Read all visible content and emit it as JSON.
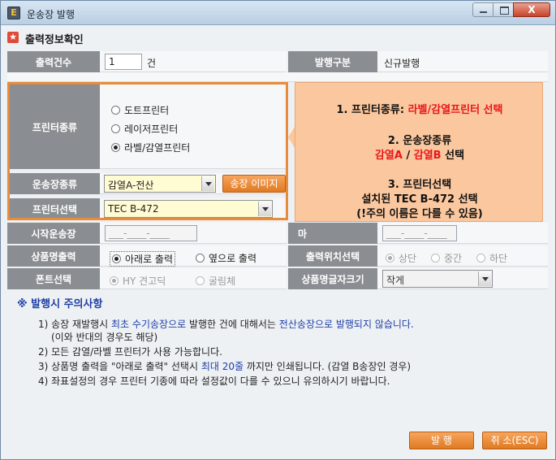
{
  "window": {
    "title": "운송장 발행",
    "close_glyph": "X",
    "app_glyph": "E"
  },
  "section": {
    "title": "출력정보확인",
    "icon_glyph": "★"
  },
  "form": {
    "print_count": {
      "label": "출력건수",
      "value": "1",
      "unit": "건"
    },
    "issue_type": {
      "label": "발행구분",
      "value": "신규발행"
    },
    "printer_type": {
      "label": "프린터종류",
      "options": [
        "도트프린터",
        "레이저프린터",
        "라벨/감열프린터"
      ],
      "selected": 2
    },
    "waybill_type": {
      "label": "운송장종류",
      "value": "감열A-전산",
      "image_button": "송장 이미지"
    },
    "printer_select": {
      "label": "프린터선택",
      "value": "TEC B-472"
    },
    "start_waybill": {
      "label": "시작운송장",
      "placeholder": "___-____-____"
    },
    "end_waybill": {
      "label": "마",
      "placeholder": "___-____-____"
    },
    "product_output": {
      "label": "상품명출력",
      "options": [
        "아래로 출력",
        "옆으로 출력"
      ],
      "selected": 0
    },
    "output_position": {
      "label": "출력위치선택",
      "options": [
        "상단",
        "중간",
        "하단"
      ],
      "selected": 0
    },
    "font_select": {
      "label": "폰트선택",
      "options": [
        "HY 견고딕",
        "굴림체"
      ],
      "selected": 0
    },
    "product_font_size": {
      "label": "상품명글자크기",
      "value": "작게"
    }
  },
  "callout": {
    "line1_prefix": "1.   프린터종류: ",
    "line1_red": "라벨/감열프린터 선택",
    "line2": "2.   운송장종류",
    "line3_a": "감열A",
    "line3_sep": " / ",
    "line3_b": "감열B",
    "line3_suffix": " 선택",
    "line4": "3. 프린터선택",
    "line5": "설치된 TEC B-472 선택",
    "line6": "(!주의 이름은 다를 수 있음)"
  },
  "notes": {
    "title": "※ 발행시 주의사항",
    "n1_a": "1) 송장 재발행시 ",
    "n1_b": "최초 수기송장으로",
    "n1_c": " 발행한 건에 대해서는 ",
    "n1_d": "전산송장으로 발행되지 않습니다.",
    "n1_sub": "(이와 반대의 경우도 해당)",
    "n2": "2) 모든 감열/라벨 프린터가 사용 가능합니다.",
    "n3_a": "3) 상품명 출력을 \"아래로 출력\" 선택시 ",
    "n3_b": "최대 20줄",
    "n3_c": " 까지만 인쇄됩니다. (감열 B송장인 경우)",
    "n4": "4) 좌표설정의 경우 프린터 기종에 따라 설정값이 다를 수 있으니 유의하시기 바랍니다."
  },
  "buttons": {
    "issue": "발  행",
    "cancel": "취 소(ESC)"
  }
}
